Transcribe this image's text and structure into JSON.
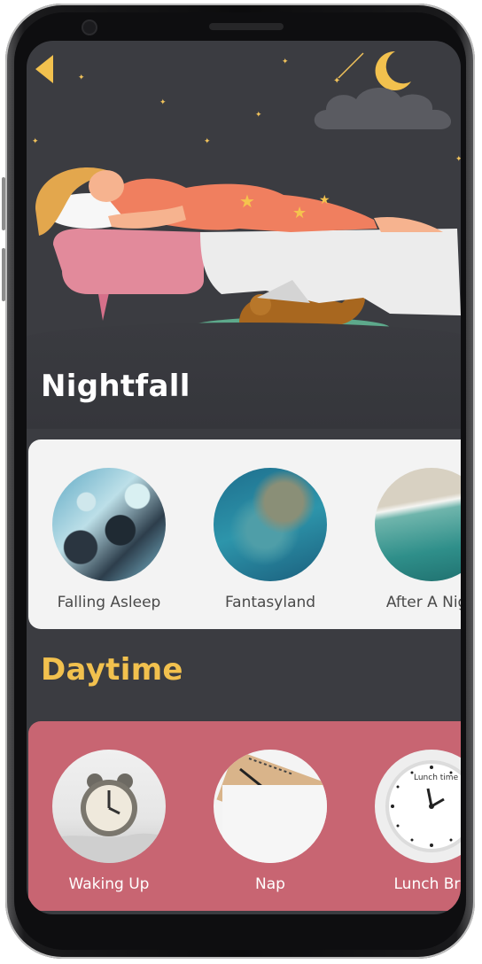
{
  "nav": {
    "back_icon": "chevron-left-icon"
  },
  "sections": [
    {
      "title": "Nightfall",
      "items": [
        {
          "label": "Falling Asleep",
          "thumb": "marble-blue-black"
        },
        {
          "label": "Fantasyland",
          "thumb": "turquoise-sea-aerial"
        },
        {
          "label": "After A Nigh",
          "thumb": "beach-wave-aerial"
        }
      ]
    },
    {
      "title": "Daytime",
      "items": [
        {
          "label": "Waking Up",
          "thumb": "alarm-clock"
        },
        {
          "label": "Nap",
          "thumb": "notebook-pen"
        },
        {
          "label": "Lunch Bre",
          "thumb": "wall-clock"
        }
      ]
    }
  ],
  "illustration": {
    "clock_text": "Lunch time"
  },
  "colors": {
    "screen_bg": "#3b3c41",
    "accent_yellow": "#f2c14e",
    "daytime_card": "#c86572",
    "nightfall_card": "#f3f3f3"
  }
}
